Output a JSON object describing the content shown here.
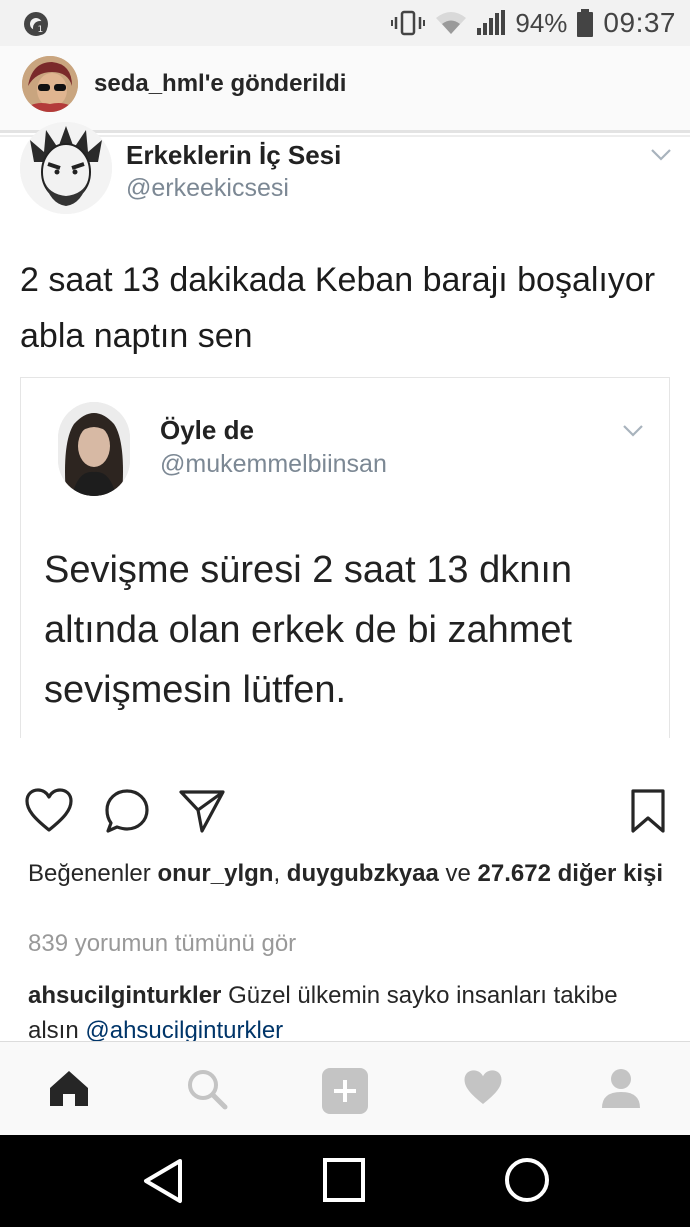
{
  "status_bar": {
    "battery": "94%",
    "time": "09:37"
  },
  "sent_header": {
    "label": "seda_hml'e gönderildi"
  },
  "tweet": {
    "name": "Erkeklerin İç Sesi",
    "handle": "@erkeekicsesi",
    "text": "2 saat 13 dakikada Keban barajı boşalıyor abla naptın sen"
  },
  "quoted_tweet": {
    "name": "Öyle de",
    "handle": "@mukemmelbiinsan",
    "text": "Sevişme süresi 2 saat 13 dknın altında olan erkek de bi zahmet sevişmesin lütfen."
  },
  "likes": {
    "prefix": "Beğenenler",
    "user1": "onur_ylgn",
    "separator": ",",
    "user2": "duygubzkyaa",
    "connector": "ve",
    "count_text": "27.672 diğer kişi"
  },
  "comments": {
    "view_all": "839 yorumun tümünü gör",
    "first": {
      "user": "ahsucilginturkler",
      "text": "Güzel ülkemin sayko insanları takibe alsın",
      "mention": "@ahsucilginturkler"
    }
  },
  "icons": {
    "like": "heart-icon",
    "comment": "comment-bubble-icon",
    "share": "paper-plane-icon",
    "save": "bookmark-icon",
    "home": "home-icon",
    "search": "search-icon",
    "add": "plus-square-icon",
    "activity": "heart-filled-icon",
    "profile": "person-icon",
    "back": "triangle-back-icon",
    "recents": "square-recents-icon",
    "homebtn": "circle-home-icon"
  },
  "colors": {
    "mention": "#003569",
    "muted": "#999999",
    "handle": "#7c8894"
  }
}
